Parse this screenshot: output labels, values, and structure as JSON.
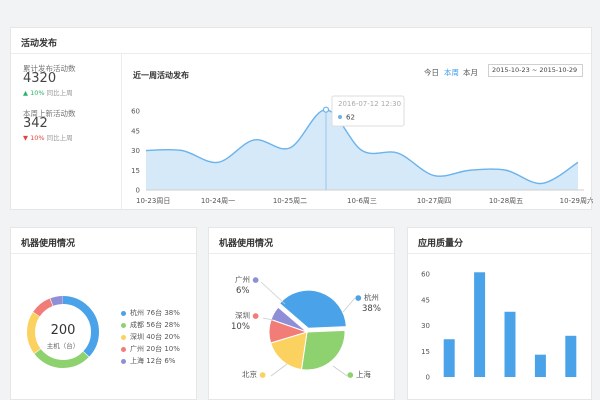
{
  "top": {
    "title": "活动发布",
    "stats": [
      {
        "label": "累计发布活动数",
        "value": "4320",
        "change": "10%",
        "direction": "up",
        "compare": "同比上周"
      },
      {
        "label": "本周上新活动数",
        "value": "342",
        "change": "10%",
        "direction": "down",
        "compare": "同比上周"
      }
    ],
    "chart_title": "近一周活动发布",
    "range_buttons": [
      "今日",
      "本周",
      "本月"
    ],
    "active_range": "本周",
    "date_range": "2015-10-23 ~ 2015-10-29",
    "tooltip": {
      "date": "2016-07-12",
      "time": "12:30",
      "value": "62"
    }
  },
  "donut": {
    "title": "机器使用情况",
    "center_value": "200",
    "center_label": "主机（台）",
    "items": [
      {
        "name": "杭州",
        "count": "76台",
        "pct": "38%",
        "color": "#4aa3e8"
      },
      {
        "name": "成都",
        "count": "56台",
        "pct": "28%",
        "color": "#8ed16f"
      },
      {
        "name": "深圳",
        "count": "40台",
        "pct": "20%",
        "color": "#fbd160"
      },
      {
        "name": "广州",
        "count": "20台",
        "pct": "10%",
        "color": "#f27d78"
      },
      {
        "name": "上海",
        "count": "12台",
        "pct": "6%",
        "color": "#8f8fd8"
      }
    ]
  },
  "pie": {
    "title": "机器使用情况",
    "labels": [
      {
        "name": "杭州",
        "pct": "38%",
        "color": "#4aa3e8"
      },
      {
        "name": "广州",
        "pct": "6%",
        "color": "#8f8fd8"
      },
      {
        "name": "深圳",
        "pct": "10%",
        "color": "#f27d78"
      },
      {
        "name": "北京",
        "color": "#fbd160"
      },
      {
        "name": "上海",
        "color": "#8ed16f"
      }
    ]
  },
  "bar": {
    "title": "应用质量分"
  },
  "chart_data": [
    {
      "type": "area",
      "title": "近一周活动发布",
      "categories": [
        "10-23周日",
        "10-24周一",
        "10-25周二",
        "10-6周三",
        "10-27周四",
        "10-28周五",
        "10-29周六"
      ],
      "x": [
        0,
        0.5,
        1,
        1.5,
        2,
        2.5,
        3,
        3.5,
        4,
        4.5,
        5,
        5.5,
        6
      ],
      "values": [
        30,
        30,
        21,
        38,
        32,
        61,
        30,
        28,
        11,
        15,
        15,
        5,
        21
      ],
      "ylim": [
        0,
        60
      ],
      "yticks": [
        0,
        15,
        30,
        45,
        60
      ],
      "grid": false,
      "color": "#6ab3ec"
    },
    {
      "type": "pie",
      "title": "机器使用情况",
      "categories": [
        "杭州",
        "成都",
        "深圳",
        "广州",
        "上海"
      ],
      "values": [
        76,
        56,
        40,
        20,
        12
      ],
      "percent": [
        38,
        28,
        20,
        10,
        6
      ],
      "donut": true
    },
    {
      "type": "pie",
      "categories": [
        "杭州",
        "上海",
        "北京",
        "深圳",
        "广州"
      ],
      "values": [
        38,
        28,
        18,
        10,
        6
      ]
    },
    {
      "type": "bar",
      "title": "应用质量分",
      "values": [
        22,
        61,
        38,
        13,
        24
      ],
      "ylim": [
        0,
        60
      ],
      "yticks": [
        0,
        15,
        30,
        45,
        60
      ],
      "color": "#4aa3e8"
    }
  ]
}
